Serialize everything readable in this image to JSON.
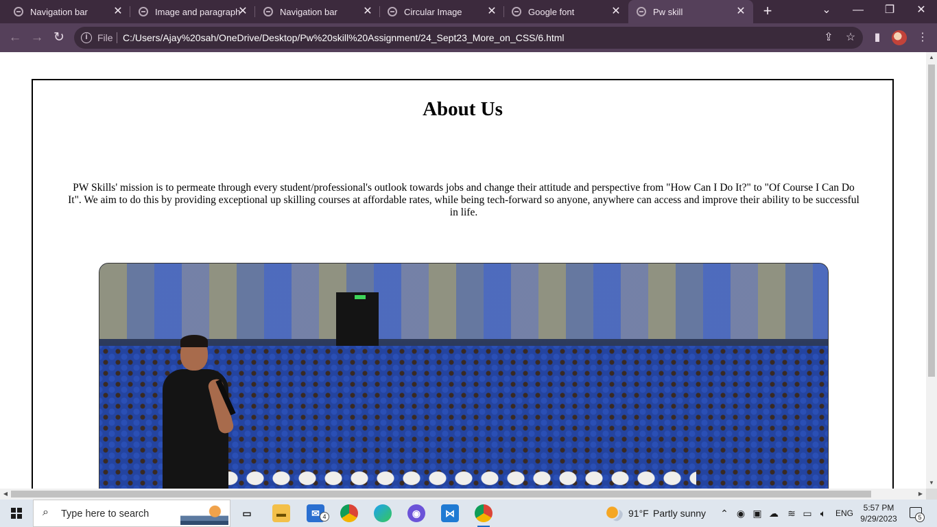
{
  "browser": {
    "tabs": [
      {
        "title": "Navigation bar",
        "active": false
      },
      {
        "title": "Image and paragraph",
        "active": false
      },
      {
        "title": "Navigation bar",
        "active": false
      },
      {
        "title": "Circular Image",
        "active": false
      },
      {
        "title": "Google font",
        "active": false
      },
      {
        "title": "Pw skill",
        "active": true
      }
    ],
    "new_tab_glyph": "+",
    "close_glyph": "✕",
    "address": {
      "scheme_label": "File",
      "url": "C:/Users/Ajay%20sah/OneDrive/Desktop/Pw%20skill%20Assignment/24_Sept23_More_on_CSS/6.html"
    }
  },
  "page": {
    "heading": "About Us",
    "paragraph": "PW Skills' mission is to permeate through every student/professional's outlook towards jobs and change their attitude and perspective from \"How Can I Do It?\" to \"Of Course I Can Do It\". We aim to do this by providing exceptional up skilling courses at affordable rates, while being tech-forward so anyone, anywhere can access and improve their ability to be successful in life."
  },
  "taskbar": {
    "search_placeholder": "Type here to search",
    "mail_badge": "4",
    "weather_temp": "91°F",
    "weather_text": "Partly sunny",
    "language": "ENG",
    "time": "5:57 PM",
    "date": "9/29/2023",
    "notification_count": "5"
  },
  "colors": {
    "tabbar_bg": "#3c2a3d",
    "toolbar_bg": "#55405a",
    "taskbar_bg": "#dfe6ee"
  }
}
